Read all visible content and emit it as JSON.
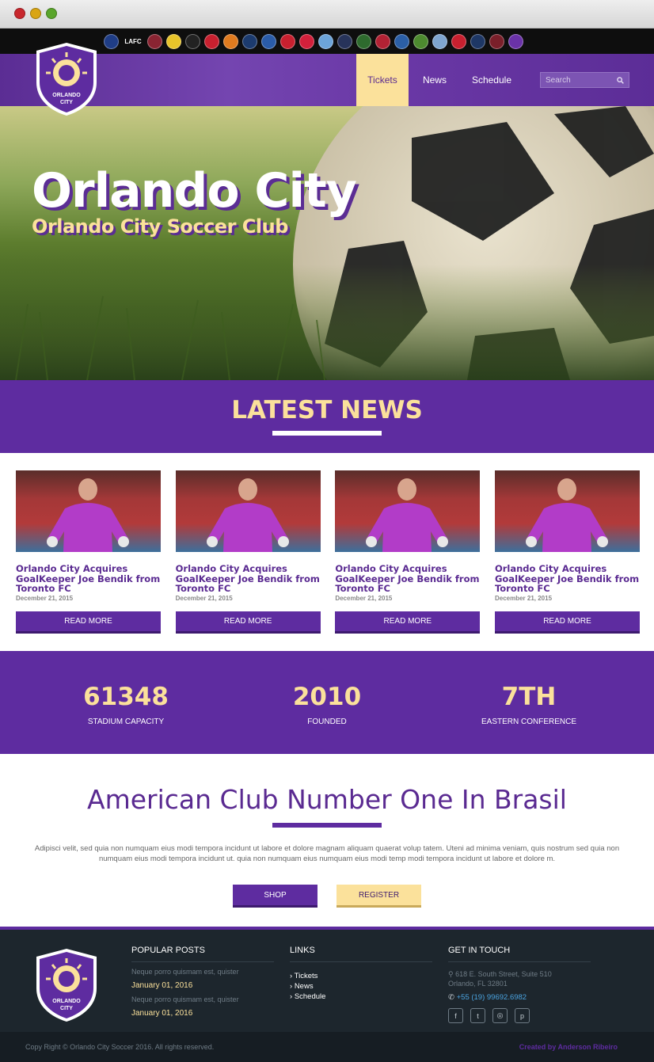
{
  "teams": [
    {
      "icon": "chicago-fire-icon",
      "color": "#1f3d86",
      "label": ""
    },
    {
      "icon": "lafc-icon",
      "color": "#0e0e0e",
      "label": "LAFC"
    },
    {
      "icon": "colorado-rapids-icon",
      "color": "#8a2432",
      "label": ""
    },
    {
      "icon": "columbus-crew-icon",
      "color": "#e8c42a",
      "label": ""
    },
    {
      "icon": "dc-united-icon",
      "color": "#222222",
      "label": ""
    },
    {
      "icon": "fc-dallas-icon",
      "color": "#c8202f",
      "label": ""
    },
    {
      "icon": "houston-dynamo-icon",
      "color": "#e07b1f",
      "label": ""
    },
    {
      "icon": "la-galaxy-icon",
      "color": "#1c3b6e",
      "label": ""
    },
    {
      "icon": "montreal-impact-icon",
      "color": "#2a5ca8",
      "label": ""
    },
    {
      "icon": "new-england-revolution-icon",
      "color": "#c8202f",
      "label": ""
    },
    {
      "icon": "ny-red-bulls-icon",
      "color": "#d3203b",
      "label": ""
    },
    {
      "icon": "nycfc-icon",
      "color": "#6ca4d9",
      "label": ""
    },
    {
      "icon": "philadelphia-union-icon",
      "color": "#27335a",
      "label": ""
    },
    {
      "icon": "portland-timbers-icon",
      "color": "#2e6b2e",
      "label": ""
    },
    {
      "icon": "real-salt-lake-icon",
      "color": "#b22234",
      "label": ""
    },
    {
      "icon": "san-jose-earthquakes-icon",
      "color": "#2b5fa6",
      "label": ""
    },
    {
      "icon": "seattle-sounders-icon",
      "color": "#4d8a2f",
      "label": ""
    },
    {
      "icon": "sporting-kc-icon",
      "color": "#7fa5cf",
      "label": ""
    },
    {
      "icon": "toronto-fc-icon",
      "color": "#c8202f",
      "label": ""
    },
    {
      "icon": "vancouver-whitecaps-icon",
      "color": "#1e3765",
      "label": ""
    },
    {
      "icon": "atlanta-united-icon",
      "color": "#7a1f2a",
      "label": ""
    },
    {
      "icon": "orlando-city-icon",
      "color": "#6a32a8",
      "label": ""
    }
  ],
  "nav": {
    "items": [
      "Tickets",
      "News",
      "Schedule"
    ],
    "search_placeholder": "Search"
  },
  "hero": {
    "title": "Orlando City",
    "subtitle": "Orlando City Soccer Club"
  },
  "news": {
    "heading": "LATEST NEWS",
    "cards": [
      {
        "title": "Orlando City Acquires GoalKeeper Joe Bendik from Toronto FC",
        "date": "December 21, 2015",
        "button": "READ MORE"
      },
      {
        "title": "Orlando City Acquires GoalKeeper Joe Bendik from Toronto FC",
        "date": "December 21, 2015",
        "button": "READ MORE"
      },
      {
        "title": "Orlando City Acquires GoalKeeper Joe Bendik from Toronto FC",
        "date": "December 21, 2015",
        "button": "READ MORE"
      },
      {
        "title": "Orlando City Acquires GoalKeeper Joe Bendik from Toronto FC",
        "date": "December 21, 2015",
        "button": "READ MORE"
      }
    ]
  },
  "stats": [
    {
      "value": "61348",
      "label": "STADIUM CAPACITY"
    },
    {
      "value": "2010",
      "label": "FOUNDED"
    },
    {
      "value": "7TH",
      "label": "EASTERN CONFERENCE"
    }
  ],
  "about": {
    "heading": "American Club Number One In Brasil",
    "body": "Adipisci velit, sed quia non numquam eius modi tempora incidunt ut labore et dolore magnam aliquam quaerat volup tatem. Uteni ad minima veniam, quis nostrum sed quia non numquam eius modi tempora incidunt ut. quia non numquam eius numquam eius modi temp modi tempora incidunt ut labore et dolore m.",
    "shop_label": "SHOP",
    "register_label": "REGISTER"
  },
  "footer": {
    "popular_heading": "POPULAR POSTS",
    "posts": [
      {
        "text": "Neque porro quismam est, quister",
        "date": "January 01, 2016"
      },
      {
        "text": "Neque porro quismam est, quister",
        "date": "January 01, 2016"
      }
    ],
    "links_heading": "LINKS",
    "links": [
      "Tickets",
      "News",
      "Schedule"
    ],
    "contact_heading": "GET IN TOUCH",
    "address_line1": "618 E. South Street, Suite 510",
    "address_line2": "Orlando, FL 32801",
    "phone": "+55 (19) 99692.6982",
    "socials": [
      {
        "icon": "facebook-icon",
        "glyph": "f"
      },
      {
        "icon": "twitter-icon",
        "glyph": "t"
      },
      {
        "icon": "instagram-icon",
        "glyph": "◎"
      },
      {
        "icon": "pinterest-icon",
        "glyph": "p"
      }
    ],
    "copyright": "Copy Right © Orlando City Soccer 2016. All rights reserved.",
    "credit": "Created by Anderson Ribeiro"
  },
  "logo_text": [
    "ORLANDO",
    "CITY"
  ],
  "colors": {
    "purple": "#5e2ca0",
    "gold": "#fbe19b",
    "footer": "#1d262d"
  }
}
